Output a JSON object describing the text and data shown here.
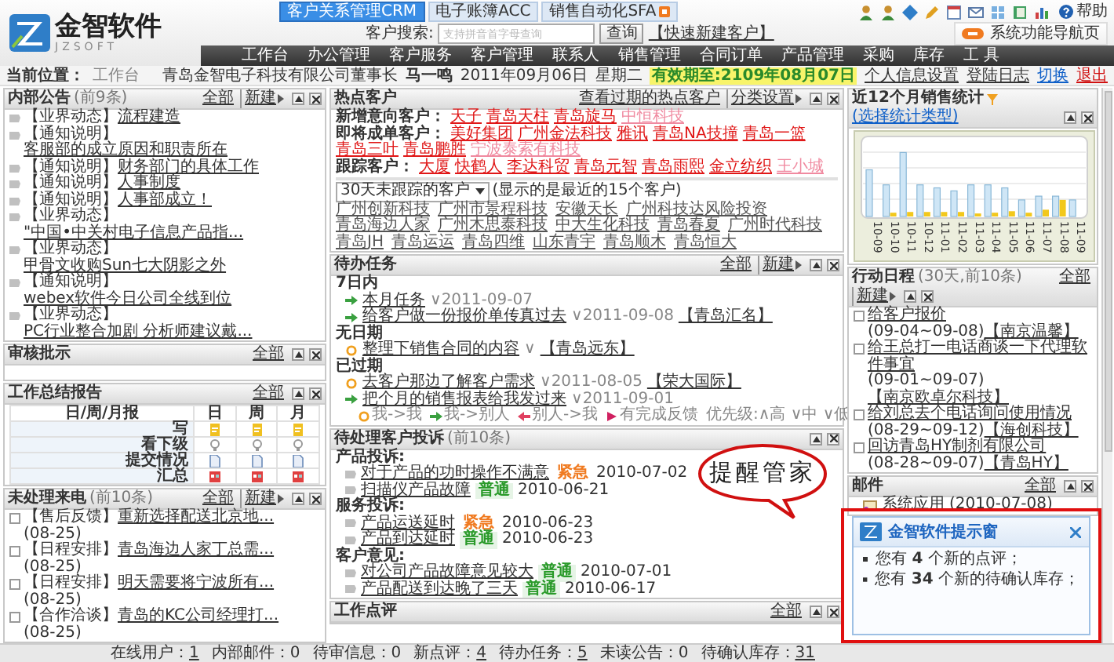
{
  "header": {
    "logo": {
      "name": "金智软件",
      "sub": "JZSOFT"
    },
    "app_tabs": [
      {
        "label": "客户关系管理CRM",
        "selected": true,
        "badge": false
      },
      {
        "label": "电子账簿ACC",
        "selected": false,
        "badge": false
      },
      {
        "label": "销售自动化SFA",
        "selected": false,
        "badge": true
      }
    ],
    "search": {
      "label": "客户搜索:",
      "placeholder": "支持拼音首字母查询",
      "button": "查询",
      "link": "【快速新建客户】"
    },
    "help": "帮助",
    "nav_page": "系统功能导航页"
  },
  "nav": [
    "工作台",
    "办公管理",
    "客户服务",
    "客户管理",
    "联系人",
    "销售管理",
    "合同订单",
    "产品管理",
    "采购",
    "库存",
    "工 具"
  ],
  "breadcrumb": {
    "label": "当前位置：",
    "page": "工作台",
    "company": "青岛金智电子科技有限公司董事长",
    "user": "马一鸣",
    "date": "2011年09月06日",
    "weekday": "星期二",
    "validity": "有效期至:2109年08月07日",
    "links": [
      {
        "label": "个人信息设置",
        "color": "#333333"
      },
      {
        "label": "登陆日志",
        "color": "#333333"
      },
      {
        "label": "切换",
        "color": "#1060c8"
      },
      {
        "label": "退出",
        "color": "#d01010"
      }
    ]
  },
  "columns": [
    {
      "panels": [
        {
          "kind": "notices",
          "title": "内部公告",
          "note": "(前9条)",
          "actions": [
            {
              "label": "全部",
              "menu": false
            },
            {
              "label": "新建",
              "menu": true
            }
          ],
          "items": [
            {
              "tag": "【业界动态】",
              "text": "流程建造"
            },
            {
              "tag": "【通知说明】",
              "text": "客服部的成立原因和职责所在"
            },
            {
              "tag": "【通知说明】",
              "text": "财务部门的具体工作"
            },
            {
              "tag": "【通知说明】",
              "text": "人事制度"
            },
            {
              "tag": "【通知说明】",
              "text": "人事部成立！"
            },
            {
              "tag": "【业界动态】",
              "text": "\"中国•中关村电子信息产品指..."
            },
            {
              "tag": "【业界动态】",
              "text": "甲骨文收购Sun七大阴影之外"
            },
            {
              "tag": "【通知说明】",
              "text": "webex软件今日公司全线到位"
            },
            {
              "tag": "【业界动态】",
              "text": "PC行业整合加剧 分析师建议戴..."
            }
          ]
        },
        {
          "kind": "empty",
          "title": "审核批示",
          "actions": [
            {
              "label": "全部",
              "menu": false
            }
          ]
        },
        {
          "kind": "report_table",
          "title": "工作总结报告",
          "actions": [
            {
              "label": "全部",
              "menu": false
            }
          ],
          "columns": [
            "日/周/月报",
            "日",
            "周",
            "月"
          ],
          "rows": [
            "写",
            "看下级",
            "提交情况",
            "汇总"
          ]
        },
        {
          "kind": "calls",
          "title": "未处理来电",
          "note": "(前10条)",
          "actions": [
            {
              "label": "全部",
              "menu": false
            },
            {
              "label": "新建",
              "menu": true
            }
          ],
          "items": [
            {
              "tag": "【售后反馈】",
              "text": "重新选择配送北京地...",
              "date": "(08-25)"
            },
            {
              "tag": "【日程安排】",
              "text": "青岛海边人家丁总需...",
              "date": "(08-25)"
            },
            {
              "tag": "【日程安排】",
              "text": "明天需要将宁波所有...",
              "date": "(08-25)"
            },
            {
              "tag": "【合作洽谈】",
              "text": "青岛的KC公司经理打...",
              "date": "(08-25)"
            }
          ]
        }
      ]
    },
    {
      "panels": [
        {
          "kind": "hot_customers",
          "title": "热点客户",
          "actions": [
            {
              "label": "查看过期的热点客户",
              "menu": false
            },
            {
              "label": "分类设置",
              "menu": true
            }
          ],
          "groups": [
            {
              "label": "新增意向客户：",
              "names": [
                {
                  "name": "天子",
                  "faded": false
                },
                {
                  "name": "青岛天柱",
                  "faded": false
                },
                {
                  "name": "青岛旋马",
                  "faded": false
                },
                {
                  "name": "中恒科技",
                  "faded": true
                }
              ]
            },
            {
              "label": "即将成单客户：",
              "names": [
                {
                  "name": "美好集团",
                  "faded": false
                },
                {
                  "name": "广州金法科技",
                  "faded": false
                },
                {
                  "name": "雅讯",
                  "faded": false
                },
                {
                  "name": "青岛NA技撞",
                  "faded": false
                },
                {
                  "name": "青岛一篮",
                  "faded": false
                },
                {
                  "name": "青岛三叶",
                  "faded": false
                },
                {
                  "name": "青岛鹏胜",
                  "faded": false
                },
                {
                  "name": "宁波泰索有科技",
                  "faded": true
                }
              ]
            },
            {
              "label": "跟踪客户：",
              "names": [
                {
                  "name": "大厦",
                  "faded": false
                },
                {
                  "name": "快鹤人",
                  "faded": false
                },
                {
                  "name": "李达科贸",
                  "faded": false
                },
                {
                  "name": "青岛元智",
                  "faded": false
                },
                {
                  "name": "青岛雨熙",
                  "faded": false
                },
                {
                  "name": "金立纺织",
                  "faded": false
                },
                {
                  "name": "王小城",
                  "faded": true
                }
              ]
            }
          ],
          "filter": "30天未跟踪的客户",
          "filter_note": "(显示的是最近的15个客户)",
          "recent": [
            "广州创新科技",
            "广州市景程科技",
            "安徽天长",
            "广州科技达风险投资",
            "青岛海边人家",
            "广州木思泰科技",
            "中大生化科技",
            "青岛春夏",
            "广州时代科技",
            "青岛JH",
            "青岛运运",
            "青岛四维",
            "山东青宇",
            "青岛顺木",
            "青岛恒大"
          ]
        },
        {
          "kind": "tasks",
          "title": "待办任务",
          "actions": [
            {
              "label": "全部",
              "menu": false
            },
            {
              "label": "新建",
              "menu": true
            }
          ],
          "groups": [
            {
              "label": "7日内",
              "items": [
                {
                  "kind": "out",
                  "text": "本月任务",
                  "due": "∨2011-09-07"
                },
                {
                  "kind": "out",
                  "text": "给客户做一份报价单传真过去",
                  "due": "∨2011-09-08",
                  "customer": "【青岛汇名】"
                }
              ]
            },
            {
              "label": "无日期",
              "items": [
                {
                  "kind": "self",
                  "text": "整理下销售合同的内容",
                  "due": "∨",
                  "customer": "【青岛远东】"
                }
              ]
            },
            {
              "label": "已过期",
              "items": [
                {
                  "kind": "self",
                  "text": "去客户那边了解客户需求",
                  "due": "∨2011-08-05",
                  "customer": "【荣大国际】"
                },
                {
                  "kind": "out",
                  "text": "把个月的销售报表给我发过来",
                  "due": "∨2011-09-01"
                }
              ]
            }
          ],
          "legend": [
            {
              "kind": "self",
              "text": "我->我"
            },
            {
              "kind": "out",
              "text": "我->别人"
            },
            {
              "kind": "in",
              "text": "别人->我"
            },
            {
              "kind": "done",
              "text": "有完成反馈"
            }
          ],
          "priority": "优先级:∧高 ∨中 ∨低"
        },
        {
          "kind": "complaints",
          "title": "待处理客户投诉",
          "note": "(前10条)",
          "groups": [
            {
              "label": "产品投诉:",
              "items": [
                {
                  "text": "对于产品的功时操作不满意",
                  "level": "紧急",
                  "urgent": true,
                  "date": "2010-07-02"
                },
                {
                  "text": "扫描仪产品故障",
                  "level": "普通",
                  "urgent": false,
                  "date": "2010-06-21"
                }
              ]
            },
            {
              "label": "服务投诉:",
              "items": [
                {
                  "text": "产品运送延时",
                  "level": "紧急",
                  "urgent": true,
                  "date": "2010-06-23"
                },
                {
                  "text": "产品到达延时",
                  "level": "普通",
                  "urgent": false,
                  "date": "2010-06-23"
                }
              ]
            },
            {
              "label": "客户意见:",
              "items": [
                {
                  "text": "对公司产品故障意见较大",
                  "level": "普通",
                  "urgent": false,
                  "date": "2010-07-01"
                },
                {
                  "text": "产品配送到达晚了三天",
                  "level": "普通",
                  "urgent": false,
                  "date": "2010-06-17"
                }
              ]
            }
          ]
        },
        {
          "kind": "empty",
          "title": "工作点评",
          "actions": [
            {
              "label": "全部",
              "menu": false
            }
          ]
        }
      ]
    },
    {
      "panels": [
        {
          "kind": "chart",
          "title": "近12个月销售统计",
          "link": "(选择统计类型)",
          "months": [
            "10-09",
            "10-10",
            "10-11",
            "10-12",
            "11-01",
            "11-02",
            "11-03",
            "11-04",
            "11-05",
            "11-06",
            "11-07",
            "11-08",
            "11-09"
          ]
        },
        {
          "kind": "schedule",
          "title": "行动日程",
          "note": "(30天,前10条)",
          "actions": [
            {
              "label": "全部",
              "menu": false
            },
            {
              "label": "新建",
              "menu": true
            }
          ],
          "items": [
            {
              "text": "给客户报价",
              "range": "(09-04~09-08)",
              "customer": "【南京温馨】"
            },
            {
              "text": "给王总打一电话商谈一下代理软件事宜",
              "range": "(09-01~09-07)",
              "customer": "【南京欧卓尔科技】"
            },
            {
              "text": "给刘总去个电话询问使用情况",
              "range": "(08-29~09-12)",
              "customer": "【海创科技】"
            },
            {
              "text": "回访青岛HY制剂有限公司",
              "range": "(08-28~09-07)",
              "customer": "【青岛HY】"
            }
          ]
        },
        {
          "kind": "mail",
          "title": "邮件",
          "actions": [
            {
              "label": "全部",
              "menu": false
            }
          ],
          "items": [
            {
              "text": "系统应用",
              "date": "(2010-07-08)"
            }
          ]
        }
      ]
    }
  ],
  "status_bar": [
    {
      "label": "在线用户：",
      "value": "1",
      "link": true
    },
    {
      "label": "内部邮件：",
      "value": "0",
      "link": false
    },
    {
      "label": "待审信息：",
      "value": "0",
      "link": false
    },
    {
      "label": "新点评：",
      "value": "4",
      "link": true
    },
    {
      "label": "待办任务：",
      "value": "5",
      "link": true
    },
    {
      "label": "未读公告：",
      "value": "0",
      "link": false
    },
    {
      "label": "待确认库存：",
      "value": "31",
      "link": true
    }
  ],
  "callout": "提醒管家",
  "popup": {
    "title": "金智软件提示窗",
    "lines": [
      "您有 **4** 个新的点评；",
      "您有 **34** 个新的待确认库存；"
    ]
  }
}
